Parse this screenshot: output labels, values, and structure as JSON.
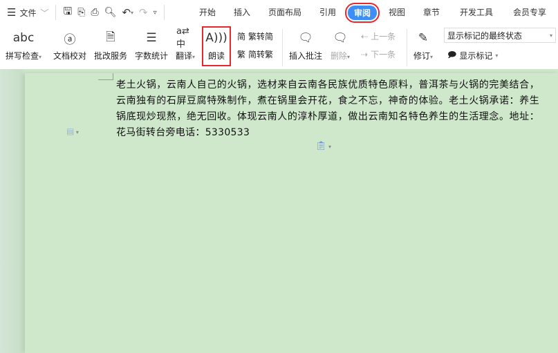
{
  "topbar": {
    "menu_label": "文件",
    "tabs": [
      "开始",
      "插入",
      "页面布局",
      "引用",
      "审阅",
      "视图",
      "章节",
      "开发工具",
      "会员专享"
    ],
    "active_tab": "审阅"
  },
  "ribbon": {
    "spell_check": "拼写检查",
    "proofread": "文档校对",
    "correction_service": "批改服务",
    "word_count": "字数统计",
    "translate": "翻译",
    "read_aloud": "朗读",
    "trad_to_simp": "繁转简",
    "simp_to_trad": "简转繁",
    "insert_comment": "插入批注",
    "delete": "删除",
    "prev": "上一条",
    "next": "下一条",
    "track_changes": "修订",
    "markup_select": "显示标记的最终状态",
    "show_markup": "显示标记"
  },
  "document": {
    "text": "老土火锅，云南人自己的火锅，选材来自云南各民族优质特色原料，普洱茶与火锅的完美结合，云南独有的石屏豆腐特殊制作，煮在锅里会开花，食之不忘，神奇的体验。老土火锅承诺：养生锅底现炒现熬，绝无回收。体现云南人的淳朴厚道，做出云南知名特色养生的生活理念。地址：花马街转台旁电话：5330533"
  }
}
